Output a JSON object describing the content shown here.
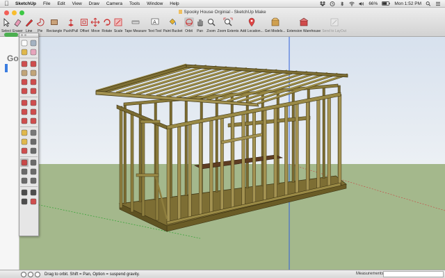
{
  "menubar": {
    "app": "SketchUp",
    "items": [
      "File",
      "Edit",
      "View",
      "Draw",
      "Camera",
      "Tools",
      "Window",
      "Help"
    ],
    "battery": "66%",
    "clock": "Mon 1:52 PM"
  },
  "window": {
    "title": "Spooky House Orginial - SketchUp Make"
  },
  "toolbar": {
    "tools": [
      {
        "label": "Select",
        "icon": "select-arrow-icon",
        "selected": false
      },
      {
        "label": "Eraser",
        "icon": "eraser-icon",
        "selected": false
      },
      {
        "label": "Line",
        "icon": "pencil-line-icon",
        "selected": false
      },
      {
        "label": "Pie",
        "icon": "pie-icon",
        "selected": false
      },
      {
        "label": "Rectangle",
        "icon": "rectangle-icon",
        "selected": false
      },
      {
        "label": "Push/Pull",
        "icon": "push-pull-icon",
        "selected": false
      },
      {
        "label": "Offset",
        "icon": "offset-icon",
        "selected": false
      },
      {
        "label": "Move",
        "icon": "move-icon",
        "selected": false
      },
      {
        "label": "Rotate",
        "icon": "rotate-icon",
        "selected": false
      },
      {
        "label": "Scale",
        "icon": "scale-icon",
        "selected": false
      },
      {
        "label": "Tape Measure",
        "icon": "tape-measure-icon",
        "selected": false
      },
      {
        "label": "Text Tool",
        "icon": "text-tool-icon",
        "selected": false
      },
      {
        "label": "Paint Bucket",
        "icon": "paint-bucket-icon",
        "selected": false
      },
      {
        "label": "Orbit",
        "icon": "orbit-icon",
        "selected": true
      },
      {
        "label": "Pan",
        "icon": "pan-hand-icon",
        "selected": false
      },
      {
        "label": "Zoom",
        "icon": "zoom-icon",
        "selected": false
      },
      {
        "label": "Zoom Extents",
        "icon": "zoom-extents-icon",
        "selected": false
      },
      {
        "label": "Add Location...",
        "icon": "add-location-icon",
        "selected": false
      },
      {
        "label": "Get Models...",
        "icon": "get-models-icon",
        "selected": false
      },
      {
        "label": "Extension Warehouse",
        "icon": "extension-warehouse-icon",
        "selected": false
      },
      {
        "label": "Send to LayOut",
        "icon": "send-to-layout-icon",
        "selected": false,
        "disabled": true
      }
    ]
  },
  "browser_behind": {
    "logo_letters": "Go"
  },
  "tool_palette": {
    "buttons": [
      "select-icon",
      "component-icon",
      "paint-bucket-icon",
      "eraser-icon",
      "sep",
      "line-icon",
      "freehand-icon",
      "rectangle-icon",
      "rotated-rectangle-icon",
      "circle-icon",
      "polygon-icon",
      "arc-icon",
      "pie-icon",
      "sep",
      "move-icon",
      "push-pull-icon",
      "rotate-icon",
      "follow-me-icon",
      "scale-icon",
      "offset-icon",
      "sep",
      "tape-measure-icon",
      "dimension-icon",
      "protractor-icon",
      "text-icon",
      "axes-icon",
      "3d-text-icon",
      "sep",
      "orbit-icon",
      "pan-icon",
      "zoom-icon",
      "zoom-window-icon",
      "zoom-extents-icon",
      "previous-view-icon",
      "sep",
      "walk-icon",
      "look-around-icon",
      "position-camera-icon",
      "section-plane-icon"
    ],
    "selected": "orbit-icon"
  },
  "statusbar": {
    "hint": "Drag to orbit. Shift = Pan, Option = suspend gravity.",
    "measurements_label": "Measurements",
    "measurements_value": ""
  },
  "colors": {
    "sky": "#dfe6ef",
    "ground": "#a3b78c",
    "wood": "#8a7a3c",
    "wood_dark": "#5c5022",
    "axis_blue": "#2f5fd8",
    "axis_green": "#3aa53a"
  }
}
